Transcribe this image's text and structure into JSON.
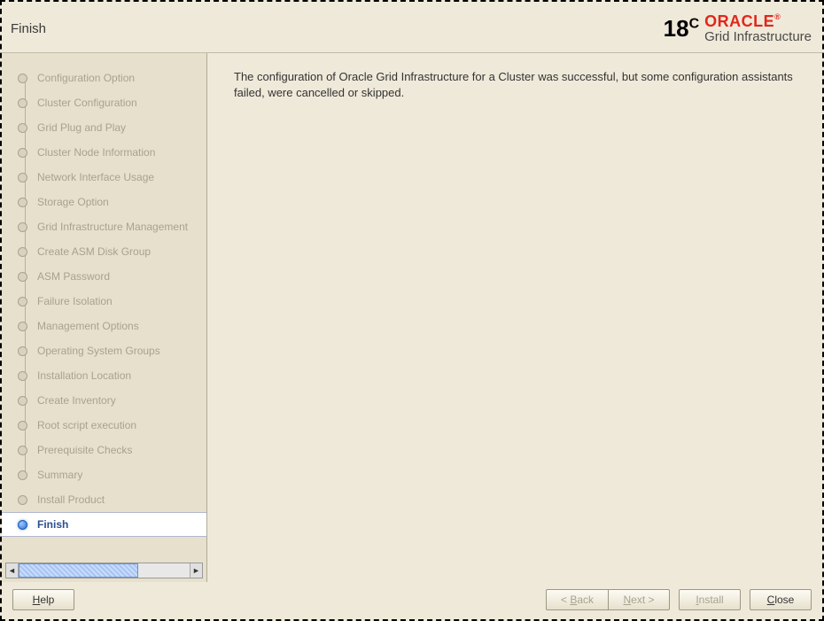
{
  "header": {
    "title": "Finish",
    "logo_version": "18",
    "logo_version_suffix": "C",
    "logo_brand": "ORACLE",
    "logo_product": "Grid Infrastructure"
  },
  "sidebar": {
    "steps": [
      {
        "label": "Configuration Option",
        "active": false
      },
      {
        "label": "Cluster Configuration",
        "active": false
      },
      {
        "label": "Grid Plug and Play",
        "active": false
      },
      {
        "label": "Cluster Node Information",
        "active": false
      },
      {
        "label": "Network Interface Usage",
        "active": false
      },
      {
        "label": "Storage Option",
        "active": false
      },
      {
        "label": "Grid Infrastructure Management",
        "active": false
      },
      {
        "label": "Create ASM Disk Group",
        "active": false
      },
      {
        "label": "ASM Password",
        "active": false
      },
      {
        "label": "Failure Isolation",
        "active": false
      },
      {
        "label": "Management Options",
        "active": false
      },
      {
        "label": "Operating System Groups",
        "active": false
      },
      {
        "label": "Installation Location",
        "active": false
      },
      {
        "label": "Create Inventory",
        "active": false
      },
      {
        "label": "Root script execution",
        "active": false
      },
      {
        "label": "Prerequisite Checks",
        "active": false
      },
      {
        "label": "Summary",
        "active": false
      },
      {
        "label": "Install Product",
        "active": false
      },
      {
        "label": "Finish",
        "active": true
      }
    ]
  },
  "main": {
    "message": "The configuration of Oracle Grid Infrastructure for a Cluster was successful, but some configuration assistants failed, were cancelled or skipped."
  },
  "footer": {
    "help_label": "Help",
    "back_label": "< Back",
    "next_label": "Next >",
    "install_label": "Install",
    "close_label": "Close",
    "back_enabled": false,
    "next_enabled": false,
    "install_enabled": false,
    "close_enabled": true
  }
}
